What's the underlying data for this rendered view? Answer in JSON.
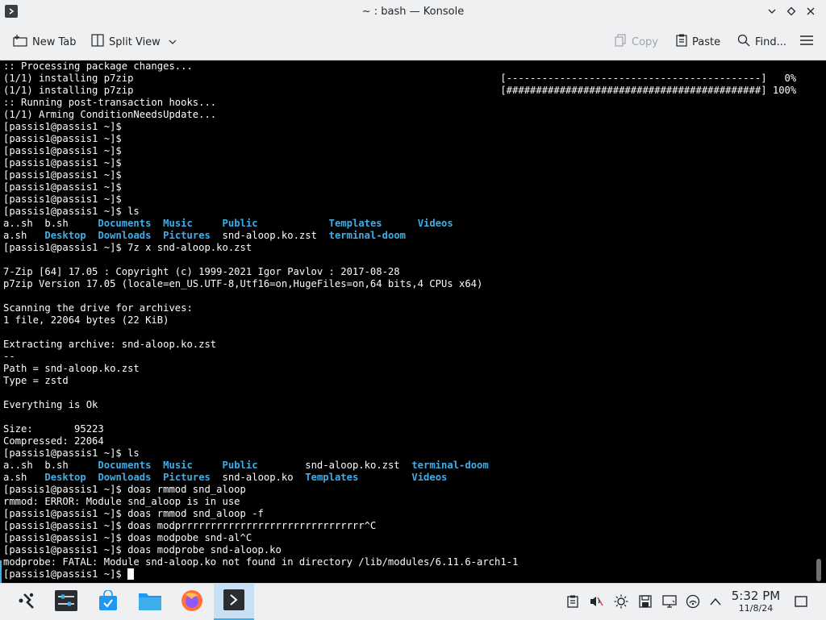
{
  "window": {
    "title": "~ : bash — Konsole"
  },
  "toolbar": {
    "new_tab": "New Tab",
    "split_view": "Split View",
    "copy": "Copy",
    "paste": "Paste",
    "find": "Find..."
  },
  "terminal": {
    "lines": [
      [
        {
          "t": ":: Processing package changes..."
        }
      ],
      [
        {
          "t": "(1/1) installing p7zip                                                              [-------------------------------------------]   0%"
        }
      ],
      [
        {
          "t": "(1/1) installing p7zip                                                              [###########################################] 100%"
        }
      ],
      [
        {
          "t": ":: Running post-transaction hooks..."
        }
      ],
      [
        {
          "t": "(1/1) Arming ConditionNeedsUpdate..."
        }
      ],
      [
        {
          "t": "[passis1@passis1 ~]$"
        }
      ],
      [
        {
          "t": "[passis1@passis1 ~]$"
        }
      ],
      [
        {
          "t": "[passis1@passis1 ~]$"
        }
      ],
      [
        {
          "t": "[passis1@passis1 ~]$"
        }
      ],
      [
        {
          "t": "[passis1@passis1 ~]$"
        }
      ],
      [
        {
          "t": "[passis1@passis1 ~]$"
        }
      ],
      [
        {
          "t": "[passis1@passis1 ~]$"
        }
      ],
      [
        {
          "t": "[passis1@passis1 ~]$ ls"
        }
      ],
      [
        {
          "t": "a..sh  b.sh     "
        },
        {
          "t": "Documents",
          "c": "dir"
        },
        {
          "t": "  "
        },
        {
          "t": "Music",
          "c": "dir"
        },
        {
          "t": "     "
        },
        {
          "t": "Public",
          "c": "dir"
        },
        {
          "t": "            "
        },
        {
          "t": "Templates",
          "c": "dir"
        },
        {
          "t": "      "
        },
        {
          "t": "Videos",
          "c": "dir"
        }
      ],
      [
        {
          "t": "a.sh   "
        },
        {
          "t": "Desktop",
          "c": "dir"
        },
        {
          "t": "  "
        },
        {
          "t": "Downloads",
          "c": "dir"
        },
        {
          "t": "  "
        },
        {
          "t": "Pictures",
          "c": "dir"
        },
        {
          "t": "  snd-aloop.ko.zst  "
        },
        {
          "t": "terminal-doom",
          "c": "dir"
        }
      ],
      [
        {
          "t": "[passis1@passis1 ~]$ 7z x snd-aloop.ko.zst"
        }
      ],
      [
        {
          "t": ""
        }
      ],
      [
        {
          "t": "7-Zip [64] 17.05 : Copyright (c) 1999-2021 Igor Pavlov : 2017-08-28"
        }
      ],
      [
        {
          "t": "p7zip Version 17.05 (locale=en_US.UTF-8,Utf16=on,HugeFiles=on,64 bits,4 CPUs x64)"
        }
      ],
      [
        {
          "t": ""
        }
      ],
      [
        {
          "t": "Scanning the drive for archives:"
        }
      ],
      [
        {
          "t": "1 file, 22064 bytes (22 KiB)"
        }
      ],
      [
        {
          "t": ""
        }
      ],
      [
        {
          "t": "Extracting archive: snd-aloop.ko.zst"
        }
      ],
      [
        {
          "t": "--"
        }
      ],
      [
        {
          "t": "Path = snd-aloop.ko.zst"
        }
      ],
      [
        {
          "t": "Type = zstd"
        }
      ],
      [
        {
          "t": ""
        }
      ],
      [
        {
          "t": "Everything is Ok"
        }
      ],
      [
        {
          "t": ""
        }
      ],
      [
        {
          "t": "Size:       95223"
        }
      ],
      [
        {
          "t": "Compressed: 22064"
        }
      ],
      [
        {
          "t": "[passis1@passis1 ~]$ ls"
        }
      ],
      [
        {
          "t": "a..sh  b.sh     "
        },
        {
          "t": "Documents",
          "c": "dir"
        },
        {
          "t": "  "
        },
        {
          "t": "Music",
          "c": "dir"
        },
        {
          "t": "     "
        },
        {
          "t": "Public",
          "c": "dir"
        },
        {
          "t": "        snd-aloop.ko.zst  "
        },
        {
          "t": "terminal-doom",
          "c": "dir"
        }
      ],
      [
        {
          "t": "a.sh   "
        },
        {
          "t": "Desktop",
          "c": "dir"
        },
        {
          "t": "  "
        },
        {
          "t": "Downloads",
          "c": "dir"
        },
        {
          "t": "  "
        },
        {
          "t": "Pictures",
          "c": "dir"
        },
        {
          "t": "  snd-aloop.ko  "
        },
        {
          "t": "Templates",
          "c": "dir"
        },
        {
          "t": "         "
        },
        {
          "t": "Videos",
          "c": "dir"
        }
      ],
      [
        {
          "t": "[passis1@passis1 ~]$ doas rmmod snd_aloop"
        }
      ],
      [
        {
          "t": "rmmod: ERROR: Module snd_aloop is in use"
        }
      ],
      [
        {
          "t": "[passis1@passis1 ~]$ doas rmmod snd_aloop -f"
        }
      ],
      [
        {
          "t": "[passis1@passis1 ~]$ doas modprrrrrrrrrrrrrrrrrrrrrrrrrrrrrrr^C"
        }
      ],
      [
        {
          "t": "[passis1@passis1 ~]$ doas modpobe snd-al^C"
        }
      ],
      [
        {
          "t": "[passis1@passis1 ~]$ doas modprobe snd-aloop.ko"
        }
      ],
      [
        {
          "t": "modprobe: FATAL: Module snd-aloop.ko not found in directory /lib/modules/6.11.6-arch1-1"
        }
      ],
      [
        {
          "t": "[passis1@passis1 ~]$ "
        },
        {
          "c": "cursor"
        }
      ]
    ]
  },
  "taskbar": {
    "apps": [
      {
        "icon": "application-launcher-icon"
      },
      {
        "icon": "system-settings-icon"
      },
      {
        "icon": "discover-store-icon"
      },
      {
        "icon": "dolphin-file-manager-icon"
      },
      {
        "icon": "firefox-icon"
      },
      {
        "icon": "konsole-icon",
        "active": true
      }
    ],
    "tray": [
      "clipboard-icon",
      "audio-muted-icon",
      "brightness-icon",
      "disks-icon",
      "display-icon",
      "network-icon",
      "show-hidden-icon"
    ],
    "clock": {
      "time": "5:32 PM",
      "date": "11/8/24"
    }
  }
}
